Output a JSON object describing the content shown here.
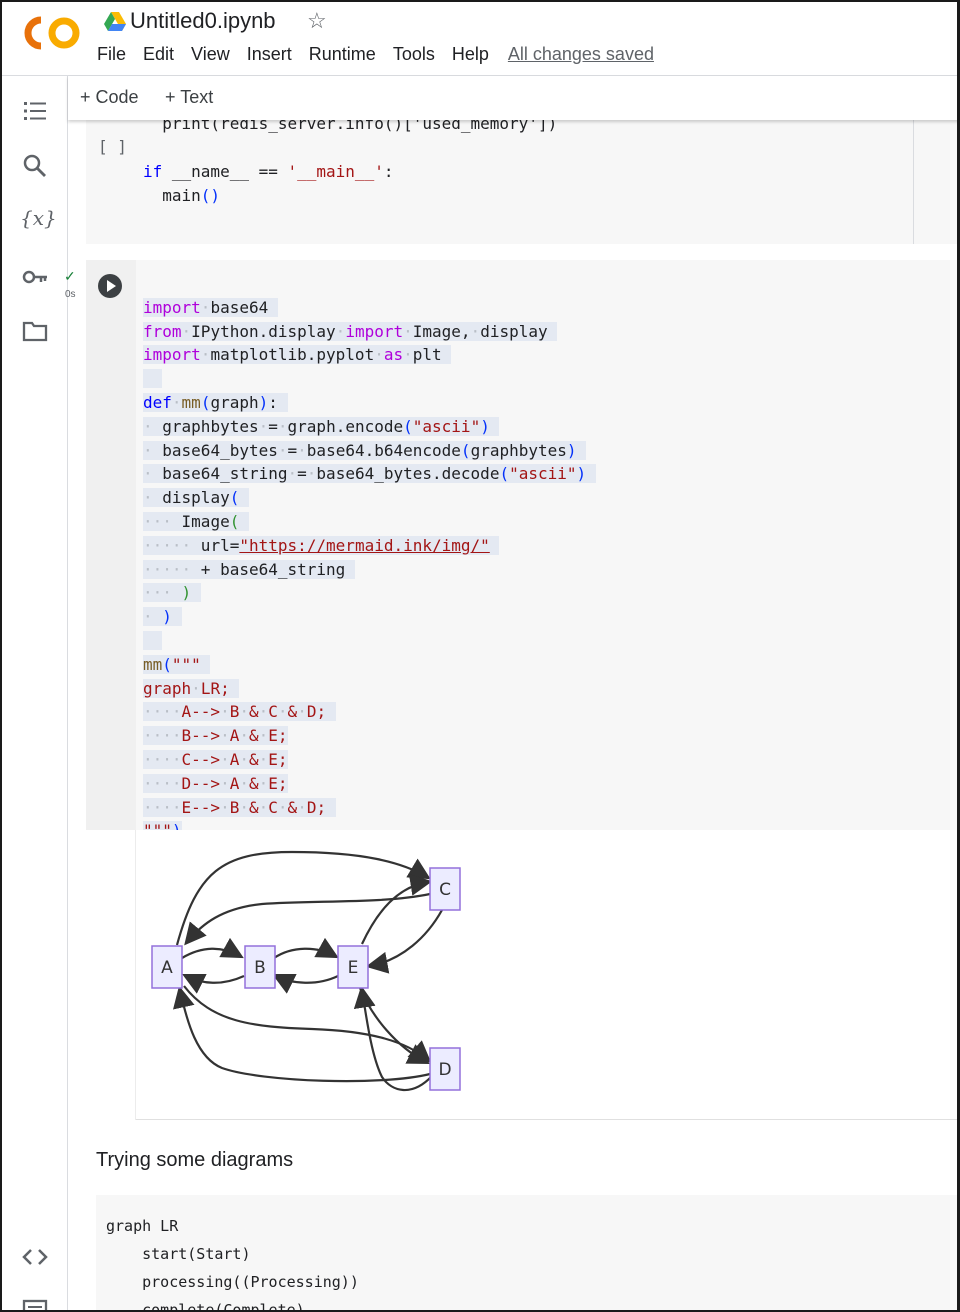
{
  "header": {
    "filename": "Untitled0.ipynb",
    "menu": [
      "File",
      "Edit",
      "View",
      "Insert",
      "Runtime",
      "Tools",
      "Help"
    ],
    "save_status": "All changes saved"
  },
  "toolbar": {
    "add_code": "Code",
    "add_text": "Text"
  },
  "top_cell": {
    "bracket": "[ ]",
    "lines": [
      "  print(redis_server.info()['used_memory'])",
      "if __name__ == '__main__':",
      "  main()"
    ]
  },
  "main_cell": {
    "status": "0s",
    "code": [
      "import base64",
      "from IPython.display import Image, display",
      "import matplotlib.pyplot as plt",
      "",
      "def mm(graph):",
      "  graphbytes = graph.encode(\"ascii\")",
      "  base64_bytes = base64.b64encode(graphbytes)",
      "  base64_string = base64_bytes.decode(\"ascii\")",
      "  display(",
      "    Image(",
      "      url=\"https://mermaid.ink/img/\"",
      "      + base64_string",
      "    )",
      "  )",
      "",
      "mm(\"\"\"",
      "graph LR;",
      "    A--> B & C & D;",
      "    B--> A & E;",
      "    C--> A & E;",
      "    D--> A & E;",
      "    E--> B & C & D;",
      "\"\"\")"
    ]
  },
  "diagram": {
    "nodes": [
      "A",
      "B",
      "C",
      "D",
      "E"
    ],
    "edges": [
      [
        "A",
        "B"
      ],
      [
        "A",
        "C"
      ],
      [
        "A",
        "D"
      ],
      [
        "B",
        "A"
      ],
      [
        "B",
        "E"
      ],
      [
        "C",
        "A"
      ],
      [
        "C",
        "E"
      ],
      [
        "D",
        "A"
      ],
      [
        "D",
        "E"
      ],
      [
        "E",
        "B"
      ],
      [
        "E",
        "C"
      ],
      [
        "E",
        "D"
      ]
    ],
    "node_fill": "#ececff",
    "node_stroke": "#9370db"
  },
  "text_cell": {
    "heading": "Trying some diagrams",
    "code": [
      "graph LR",
      "    start(Start)",
      "    processing((Processing))",
      "    complete(Complete)"
    ]
  },
  "colors": {
    "keyword": "#af00db",
    "keyword_blue": "#0000ff",
    "string": "#a31515",
    "check": "#188038",
    "logo_orange": "#f9ab00",
    "logo_dark_orange": "#e8710a"
  }
}
